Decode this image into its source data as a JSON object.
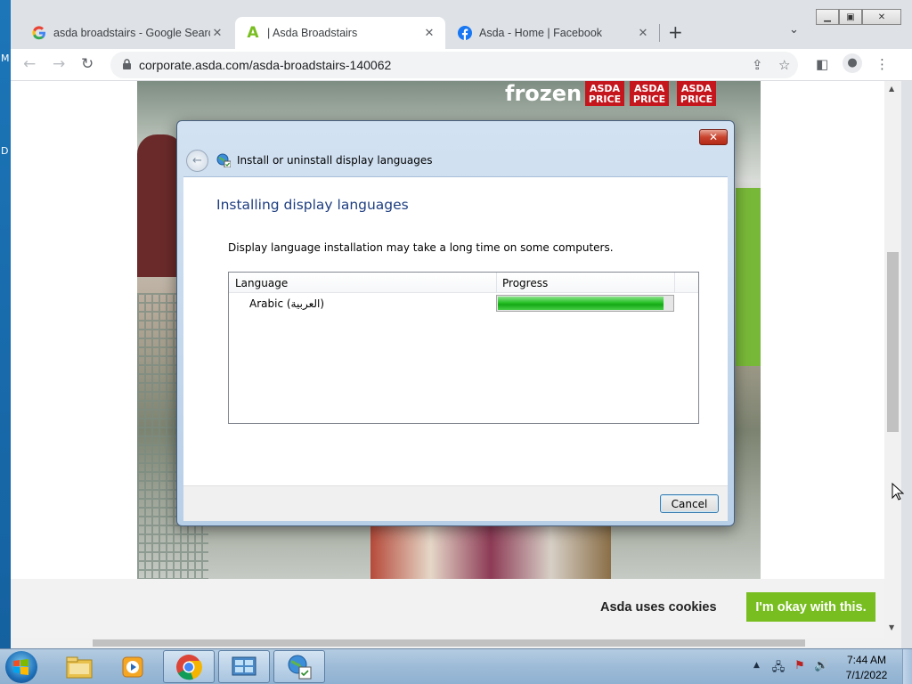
{
  "desktop": {
    "edge_letters": [
      "M",
      "D"
    ]
  },
  "browser": {
    "tabs": [
      {
        "title": "asda broadstairs - Google Search",
        "favicon": "google-g-icon",
        "active": false
      },
      {
        "title": "| Asda Broadstairs",
        "favicon": "asda-a-icon",
        "active": true
      },
      {
        "title": "Asda - Home | Facebook",
        "favicon": "facebook-f-icon",
        "active": false
      }
    ],
    "new_tab_glyph": "+",
    "url": "corporate.asda.com/asda-broadstairs-140062"
  },
  "page": {
    "photo_sign": {
      "frozen_text": "frozen fo",
      "price_tag": "ASDA PRICE"
    },
    "cookie": {
      "text": "Asda uses cookies",
      "button_label": "I'm okay with this."
    }
  },
  "dialog": {
    "title": "Install or uninstall display languages",
    "heading": "Installing display languages",
    "description": "Display language installation may take a long time on some computers.",
    "columns": {
      "language": "Language",
      "progress": "Progress"
    },
    "rows": [
      {
        "language": "Arabic (العربية)",
        "progress_percent": 95
      }
    ],
    "cancel_label": "Cancel",
    "close_glyph": "✕"
  },
  "taskbar": {
    "apps": [
      "explorer-icon",
      "media-player-icon",
      "chrome-icon",
      "control-panel-icon",
      "language-installer-icon"
    ],
    "clock": {
      "time": "7:44 AM",
      "date": "7/1/2022"
    }
  },
  "colors": {
    "asda_green": "#78be20",
    "progress_green": "#16a816",
    "heading_blue": "#1e3e80"
  }
}
